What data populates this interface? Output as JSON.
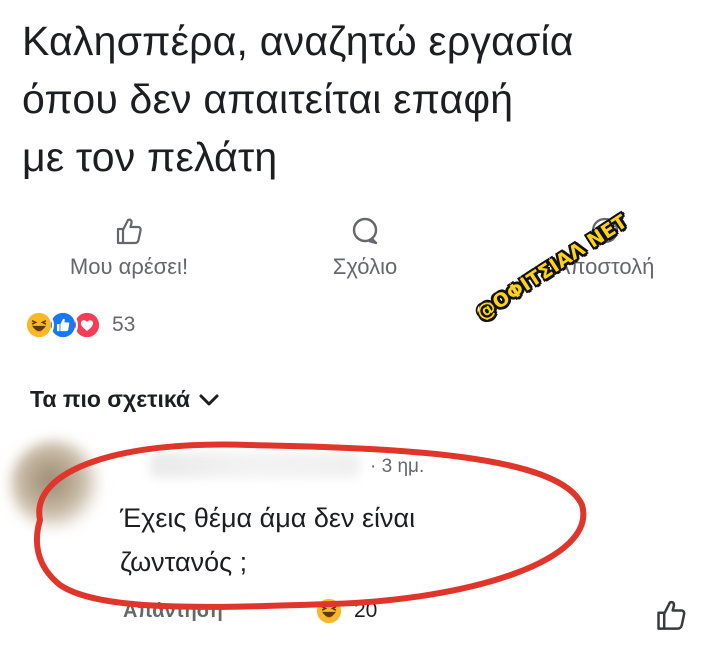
{
  "post": {
    "text_lines": [
      "Καλησπέρα, αναζητώ εργασία",
      "όπου δεν απαιτείται επαφή",
      "με τον πελάτη"
    ]
  },
  "actions": {
    "like_label": "Μου αρέσει!",
    "comment_label": "Σχόλιο",
    "send_label": "Αποστολή"
  },
  "reactions": {
    "count": "53",
    "types": [
      "haha",
      "like",
      "love"
    ]
  },
  "watermark": {
    "text": "@ΟΦΙΤΣΙΑΛ ΝΕΤ"
  },
  "comments_filter": {
    "label": "Τα πιο σχετικά"
  },
  "comment": {
    "time": "· 3 ημ.",
    "text_lines": [
      "Έχεις θέμα άμα δεν είναι",
      "ζωντανός ;"
    ],
    "reply_label": "Απάντηση",
    "reaction_count": "20"
  },
  "colors": {
    "muted": "#65676b",
    "like_blue": "#1877f2",
    "love_red": "#f33e58",
    "haha_yellow": "#f7b928",
    "oval_red": "#e0352b",
    "watermark_yellow": "#ffd21a"
  }
}
